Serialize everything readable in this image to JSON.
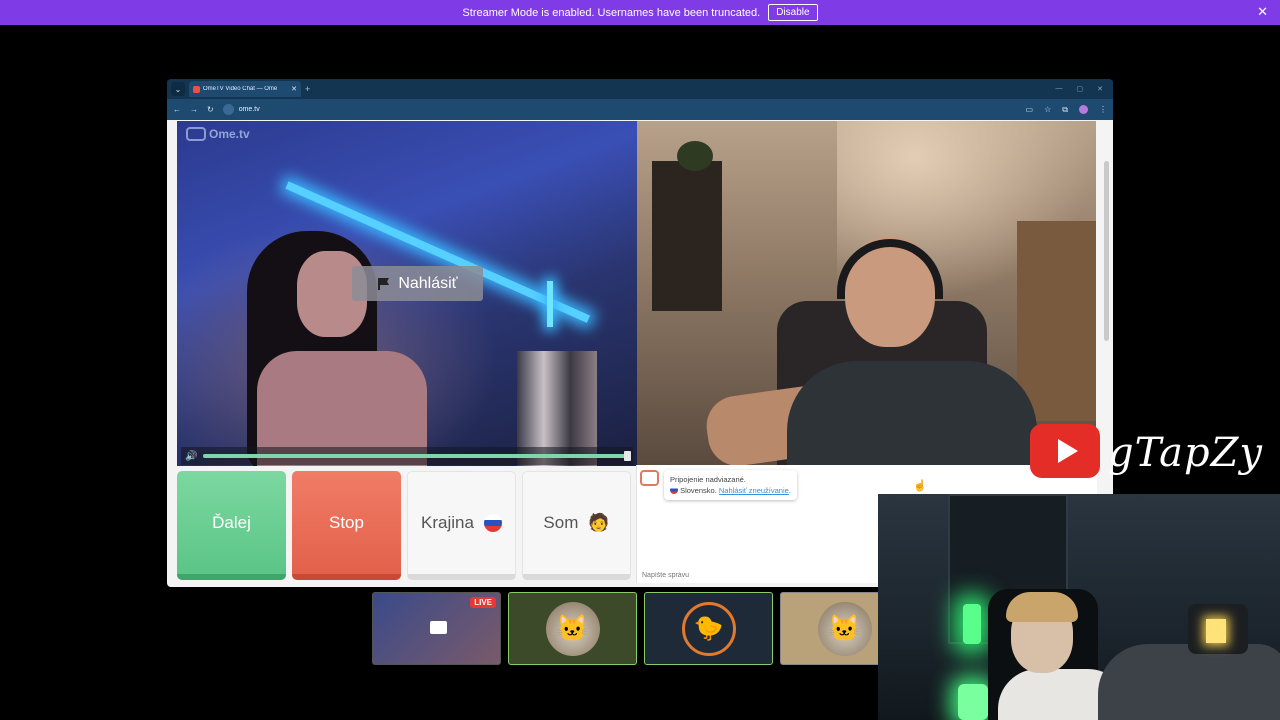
{
  "banner": {
    "message": "Streamer Mode is enabled. Usernames have been truncated.",
    "disable_label": "Disable",
    "close_glyph": "✕"
  },
  "browser": {
    "tab_title": "OmeTV Video Chat — Ome",
    "tab_close": "✕",
    "new_tab": "+",
    "url": "ome.tv",
    "menu_glyph": "⌄"
  },
  "video": {
    "logo_text": "Ome.tv",
    "report_label": "Nahlásiť"
  },
  "actions": {
    "next_label": "Ďalej",
    "stop_label": "Stop",
    "country_label": "Krajina",
    "som_label": "Som",
    "som_emoji": "🧑"
  },
  "chat": {
    "connected": "Pripojenie nadviazané.",
    "country": "Slovensko.",
    "report_abuse": "Nahlásiť zneužívanie",
    "input_placeholder": "Napíšte správu"
  },
  "thumbnails": {
    "live_badge": "LIVE",
    "items": [
      {
        "icon": "monitor-icon"
      },
      {
        "icon": "cat-santa-icon",
        "emoji": "🐱"
      },
      {
        "icon": "pixel-character-icon",
        "emoji": "🐤"
      },
      {
        "icon": "cat-icon",
        "emoji": "🐱"
      }
    ]
  },
  "overlay": {
    "channel_name": "gTapZy",
    "brand_color": "#e52d27"
  },
  "colors": {
    "banner": "#7e3be6",
    "next": "#5bc587",
    "stop": "#e2614b"
  }
}
